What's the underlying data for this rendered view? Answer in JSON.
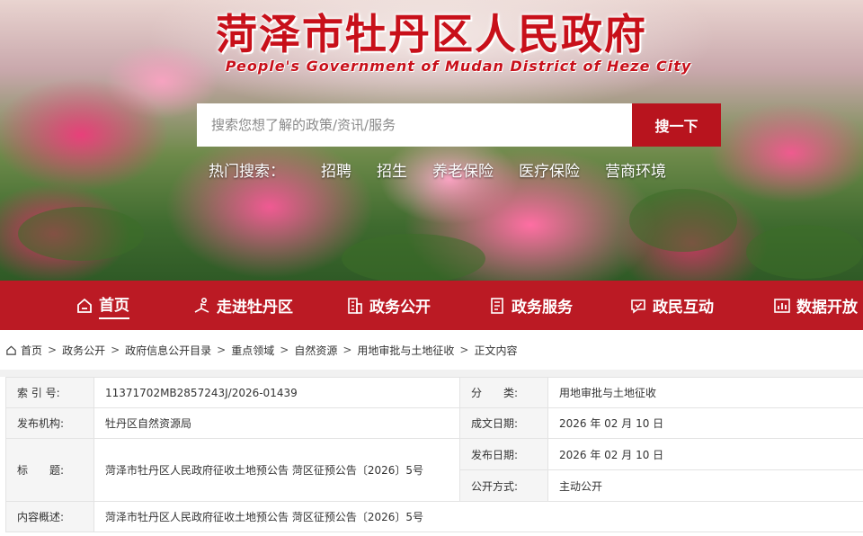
{
  "site": {
    "title": "菏泽市牡丹区人民政府",
    "subtitle": "People's Government of Mudan District of Heze City"
  },
  "search": {
    "placeholder": "搜索您想了解的政策/资讯/服务",
    "button_label": "搜一下"
  },
  "hot": {
    "label": "热门搜索：",
    "links": [
      "招聘",
      "招生",
      "养老保险",
      "医疗保险",
      "营商环境"
    ]
  },
  "nav": {
    "items": [
      {
        "label": "首页",
        "icon": "home-icon",
        "active": true
      },
      {
        "label": "走进牡丹区",
        "icon": "reading-person-icon"
      },
      {
        "label": "政务公开",
        "icon": "building-icon"
      },
      {
        "label": "政务服务",
        "icon": "document-icon"
      },
      {
        "label": "政民互动",
        "icon": "chat-check-icon"
      },
      {
        "label": "数据开放",
        "icon": "chart-icon"
      }
    ]
  },
  "breadcrumb": [
    "首页",
    "政务公开",
    "政府信息公开目录",
    "重点领域",
    "自然资源",
    "用地审批与土地征收",
    "正文内容"
  ],
  "info": {
    "index_no_label": "索 引 号:",
    "index_no": "11371702MB2857243J/2026-01439",
    "category_label": "分　　类:",
    "category": "用地审批与土地征收",
    "publisher_label": "发布机构:",
    "publisher": "牡丹区自然资源局",
    "created_label": "成文日期:",
    "created": "2026 年 02 月 10 日",
    "title_label": "标　　题:",
    "title": "菏泽市牡丹区人民政府征收土地预公告 菏区征预公告〔2026〕5号",
    "published_label": "发布日期:",
    "published": "2026 年 02 月 10 日",
    "method_label": "公开方式:",
    "method": "主动公开",
    "summary_label": "内容概述:",
    "summary": "菏泽市牡丹区人民政府征收土地预公告 菏区征预公告〔2026〕5号"
  },
  "colors": {
    "brand_red": "#bb1a24",
    "title_red": "#c8101a"
  }
}
